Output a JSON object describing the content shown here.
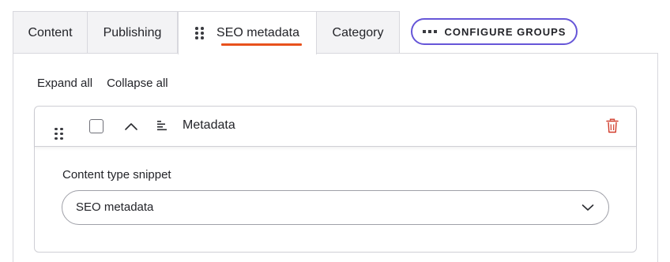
{
  "tabs": [
    {
      "label": "Content"
    },
    {
      "label": "Publishing"
    },
    {
      "label": "SEO metadata",
      "active": true
    },
    {
      "label": "Category"
    }
  ],
  "configure_button": {
    "label": "CONFIGURE GROUPS",
    "icon": "dots-horizontal-icon",
    "border_color": "#6656d8"
  },
  "toolbar": {
    "expand_all": "Expand all",
    "collapse_all": "Collapse all"
  },
  "group": {
    "title": "Metadata",
    "icons": {
      "drag": "drag-handle-icon",
      "collapse": "chevron-up-icon",
      "type": "text-align-left-icon",
      "delete": "trash-icon"
    },
    "delete_color": "#d13b2a",
    "checked": false
  },
  "field": {
    "label": "Content type snippet",
    "value": "SEO metadata"
  },
  "colors": {
    "active_tab_underline": "#e8511c"
  }
}
